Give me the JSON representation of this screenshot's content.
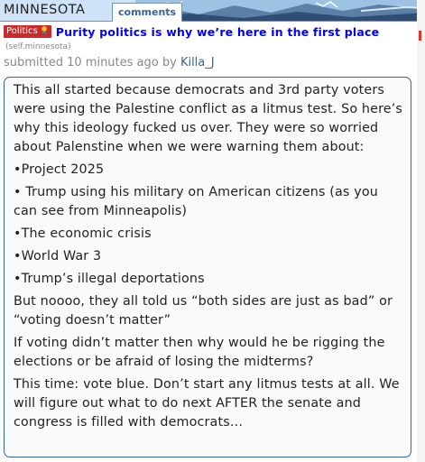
{
  "header": {
    "subreddit": "MINNESOTA",
    "tab_comments": "comments"
  },
  "post": {
    "flair": "Politics",
    "flair_icon": "award-icon",
    "title": "Purity politics is why we’re here in the first place",
    "domain_open": "(",
    "domain": "self.minnesota",
    "domain_close": ")",
    "submitted_prefix": "submitted 10 minutes ago by",
    "author": "Killa_J",
    "body": [
      "This all started because democrats and 3rd party voters were using the Palestine conflict as a litmus test. So here’s why this ideology fucked us over. They were so worried about Palenstine when we were warning them about:",
      "•Project 2025",
      "• Trump using his military on American citizens (as you can see from Minneapolis)",
      "•The economic crisis",
      "•World War 3",
      "•Trump’s illegal deportations",
      "But noooo, they all told us “both sides are just as bad” or “voting doesn’t matter”",
      "If voting didn’t matter then why would he be rigging the elections or be afraid of losing the midterms?",
      "This time: vote blue. Don’t start any litmus tests at all. We will figure out what to do next AFTER the senate and congress is filled with democrats…"
    ]
  },
  "colors": {
    "header_bg": "#cee3f8",
    "link": "#0000ff",
    "flair_bg": "#cc2a2a",
    "body_border": "#336699"
  }
}
